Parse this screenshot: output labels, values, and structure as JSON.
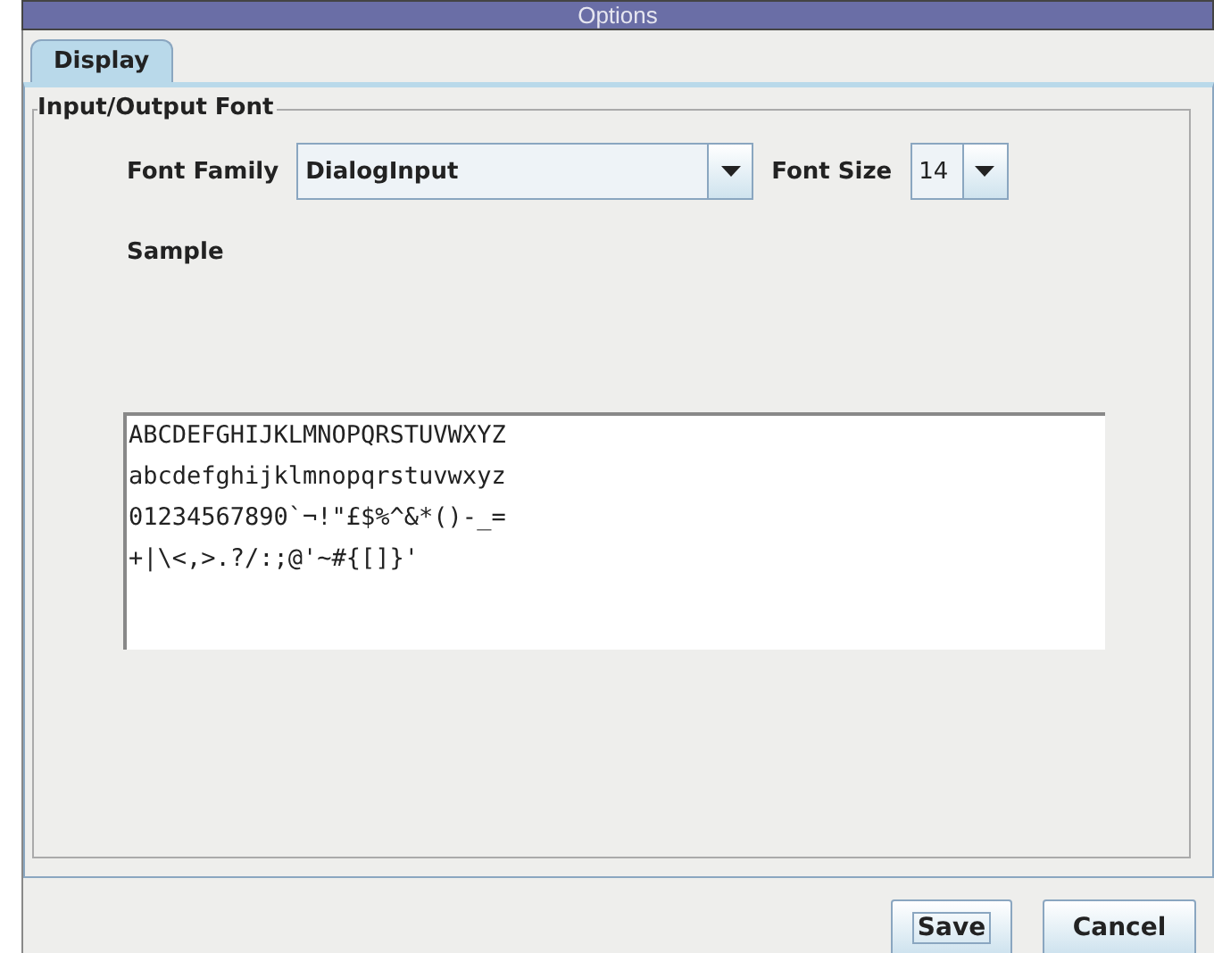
{
  "window": {
    "title": "Options"
  },
  "tabs": [
    {
      "label": "Display",
      "selected": true
    }
  ],
  "group": {
    "title": "Input/Output Font",
    "font_family": {
      "label": "Font Family",
      "value": "DialogInput"
    },
    "font_size": {
      "label": "Font Size",
      "value": "14"
    },
    "sample": {
      "label": "Sample",
      "lines": [
        "ABCDEFGHIJKLMNOPQRSTUVWXYZ",
        "abcdefghijklmnopqrstuvwxyz",
        "01234567890`¬!\"£$%^&*()-_=",
        "+|\\<,>.?/:;@'~#{[]}'"
      ]
    }
  },
  "buttons": [
    {
      "label": "Save",
      "focused": true
    },
    {
      "label": "Cancel",
      "focused": false
    }
  ]
}
